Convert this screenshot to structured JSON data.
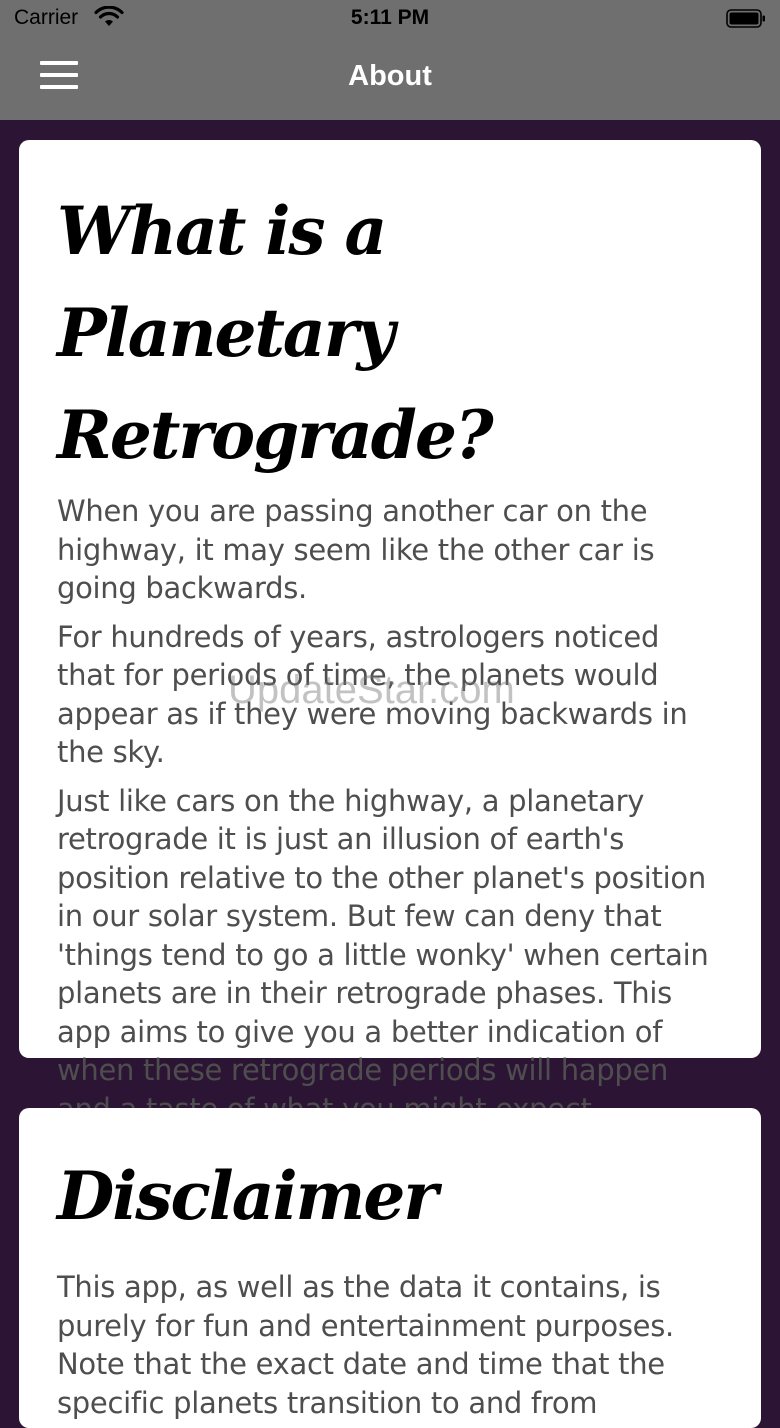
{
  "status_bar": {
    "carrier": "Carrier",
    "time": "5:11 PM",
    "icons": [
      "wifi-icon",
      "battery-icon"
    ]
  },
  "nav": {
    "title": "About",
    "menu_icon": "hamburger-menu-icon"
  },
  "sections": [
    {
      "title": "What is a Planetary Retrograde?",
      "paragraphs": [
        "When you are passing another car on the highway, it may seem like the other car is going backwards.",
        "For hundreds of years, astrologers noticed that for periods of time, the planets would appear as if they were moving backwards in the sky.",
        "Just like cars on the highway, a planetary retrograde it is just an illusion of earth's position relative to the other planet's position in our solar system. But few can deny that 'things tend to go a little wonky' when certain planets are in their retrograde phases. This app aims to give you a better indication of when these retrograde periods will happen and a taste of what you might expect."
      ]
    },
    {
      "title": "Disclaimer",
      "paragraphs": [
        "This app, as well as the data it contains, is purely for fun and entertainment purposes. Note that the exact date and time that the specific planets transition to and from"
      ]
    }
  ],
  "watermark": "UpdateStar.com",
  "colors": {
    "bar": "#6f6f6f",
    "background": "#2c1534",
    "card": "#ffffff",
    "body_text": "#4e4e4e"
  }
}
